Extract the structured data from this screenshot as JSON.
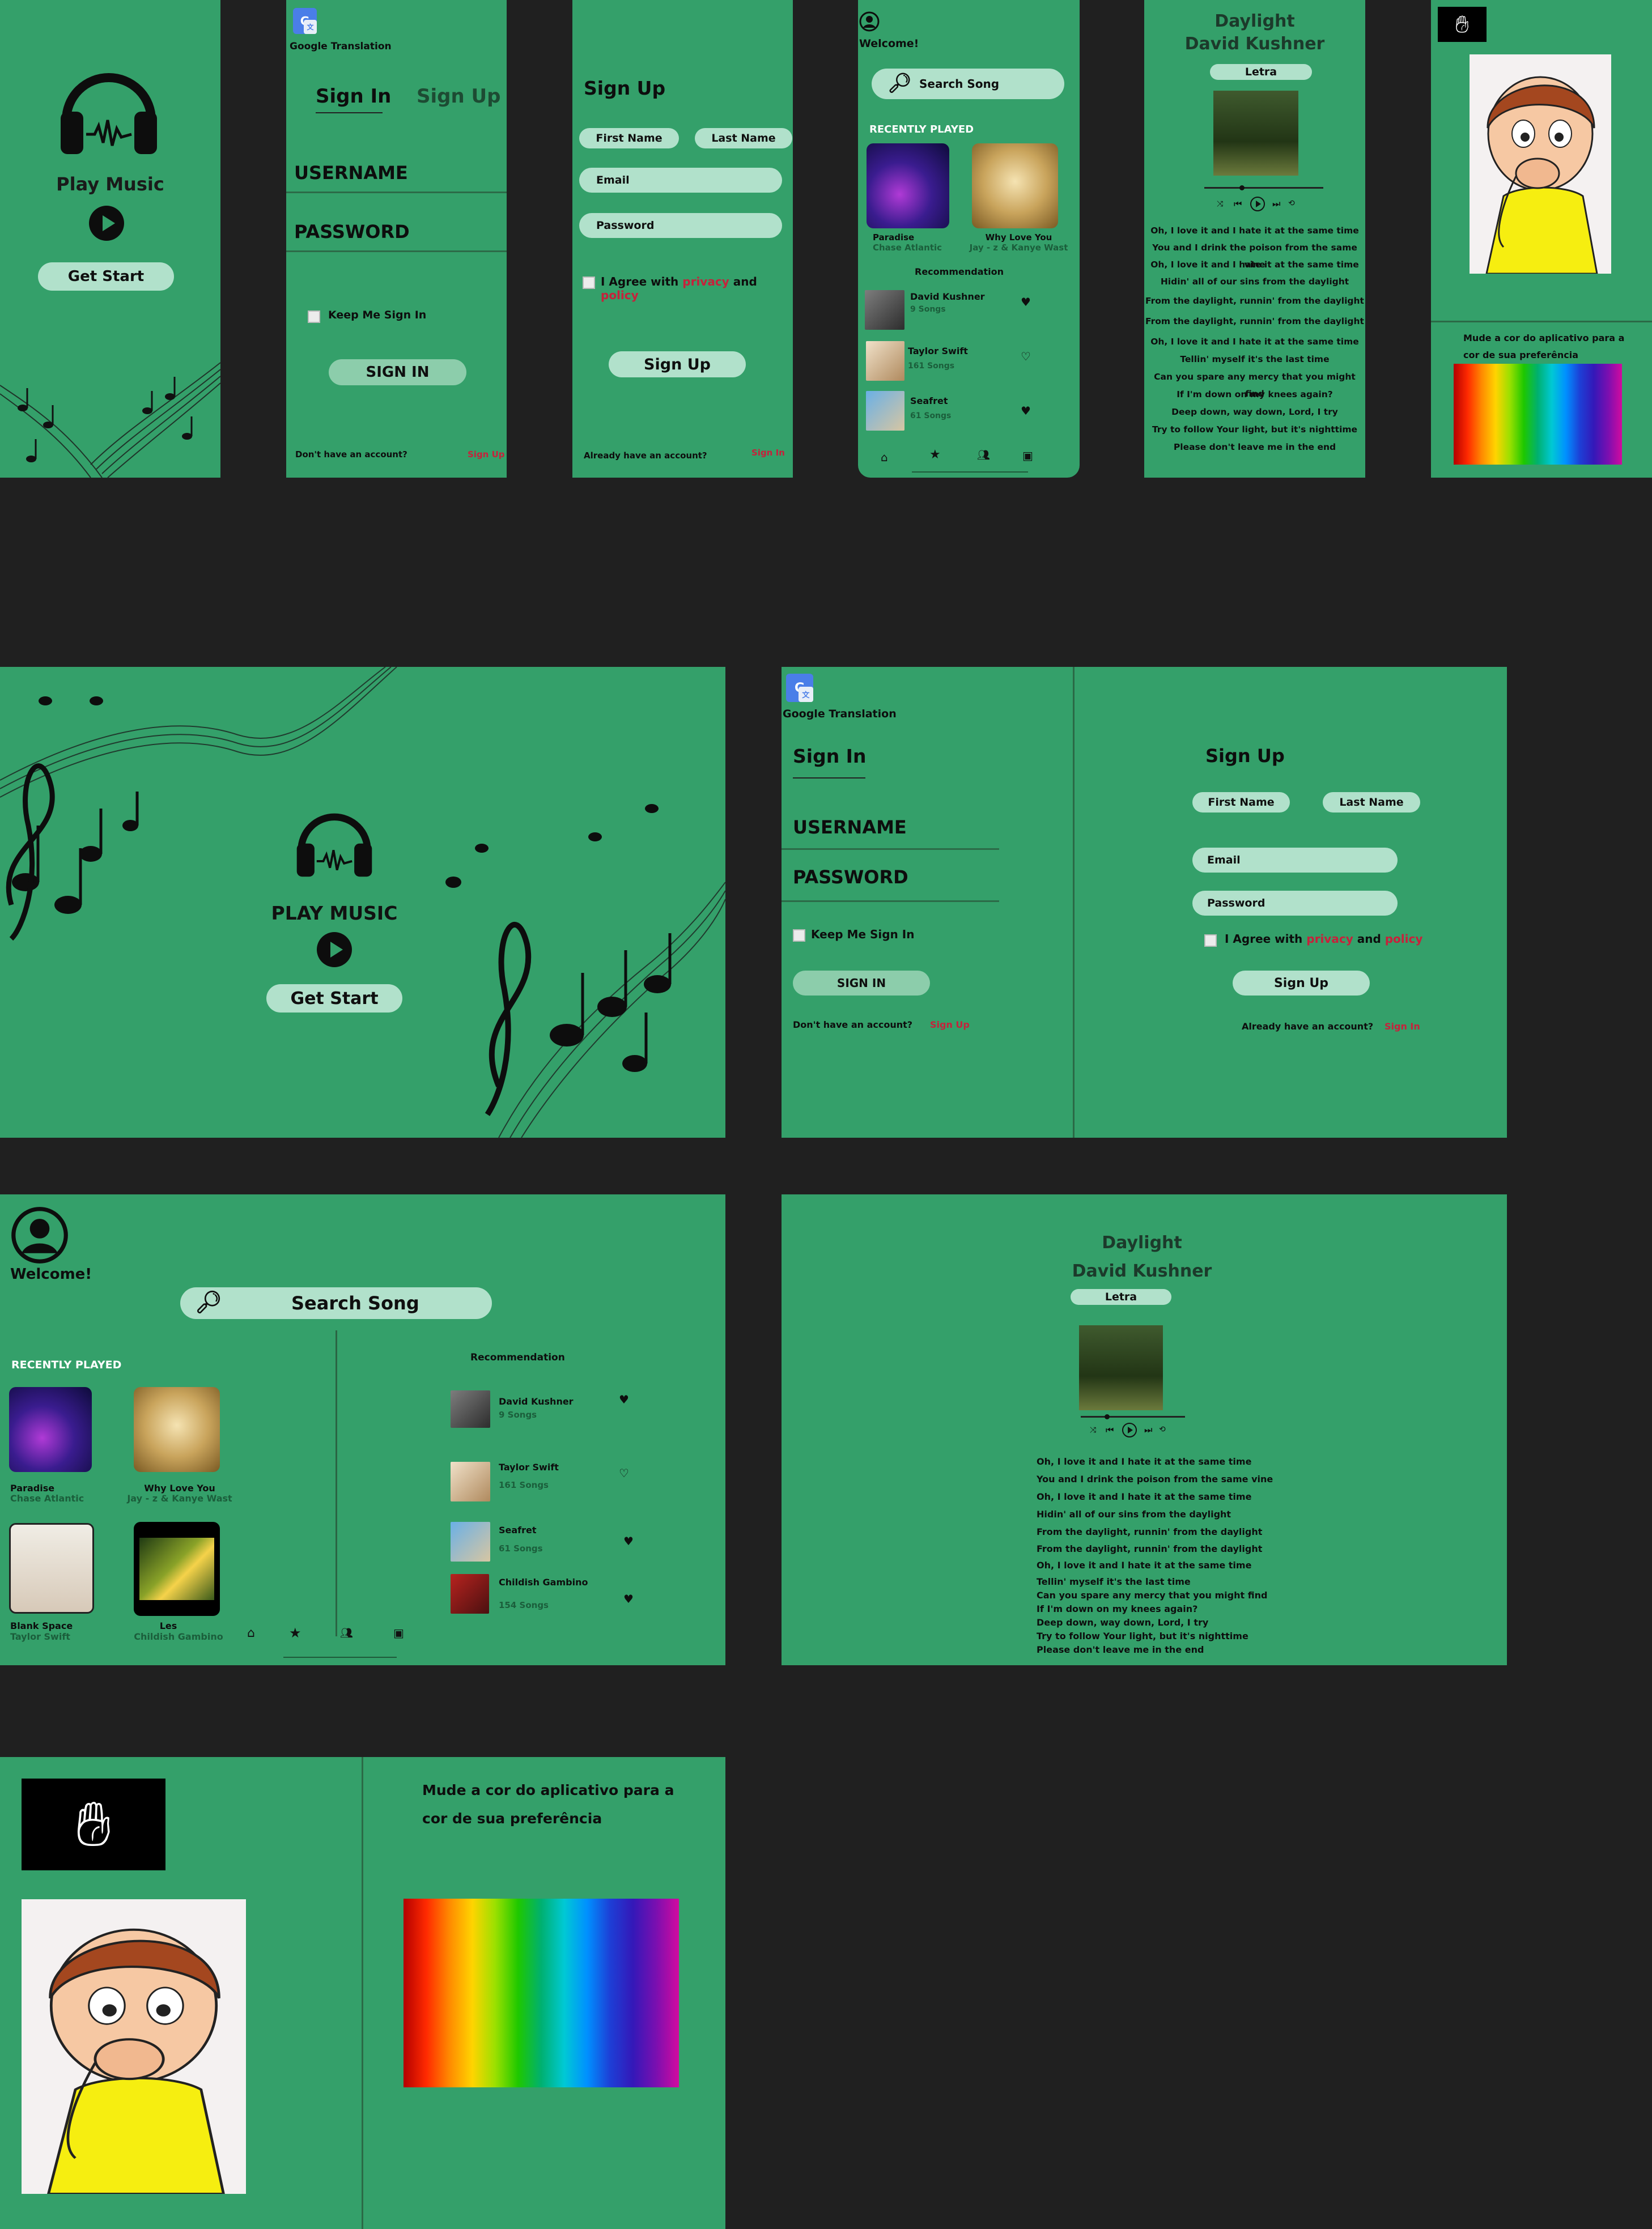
{
  "welcome": {
    "title": "Play Music",
    "title_upper": "PLAY MUSIC",
    "cta": "Get Start"
  },
  "translate": {
    "label": "Google Translation"
  },
  "signin": {
    "tab_signin": "Sign In",
    "tab_signup": "Sign Up",
    "username": "USERNAME",
    "password": "PASSWORD",
    "keep": "Keep Me Sign In",
    "button": "SIGN IN",
    "no_account": "Don't have an account?",
    "signup_link": "Sign Up"
  },
  "signup": {
    "title": "Sign Up",
    "first_name": "First Name",
    "last_name": "Last Name",
    "email": "Email",
    "password": "Password",
    "agree_prefix": "I Agree with",
    "privacy": "privacy",
    "and": "and",
    "policy": "policy",
    "button": "Sign Up",
    "have_account": "Already have an account?",
    "signin_link": "Sign In"
  },
  "home": {
    "welcome": "Welcome!",
    "search_placeholder": "Search Song",
    "recently_played": "RECENTLY PLAYED",
    "recommendation": "Recommendation",
    "recent": [
      {
        "title": "Paradise",
        "artist": "Chase Atlantic"
      },
      {
        "title": "Why Love You",
        "artist": "Jay - z  & Kanye Wast"
      },
      {
        "title": "Blank Space",
        "artist": "Taylor Swift"
      },
      {
        "title": "Les",
        "artist": "Childish Gambino"
      }
    ],
    "rec": [
      {
        "name": "David  Kushner",
        "count": "9 Songs"
      },
      {
        "name": "Taylor Swift",
        "count": "161 Songs"
      },
      {
        "name": "Seafret",
        "count": "61 Songs"
      },
      {
        "name": "Childish Gambino",
        "count": "154 Songs"
      }
    ]
  },
  "player": {
    "song": "Daylight",
    "artist": "David Kushner",
    "lyrics_tab": "Letra",
    "lyrics": [
      "Oh, I love it and I hate it at the same time",
      "You and I drink the poison from the same vine",
      "Oh, I love it and I hate it at the same time",
      "Hidin' all of our sins from the daylight",
      "From the daylight, runnin' from the daylight",
      "From the daylight, runnin' from the daylight",
      "Oh, I love it and I hate it at the same time",
      "Tellin' myself it's the last time",
      "Can you spare any mercy that you might find",
      "If I'm down on my knees again?",
      "Deep down, way down, Lord, I try",
      "Try to follow Your light, but it's nighttime",
      "Please don't leave me in the end"
    ]
  },
  "settings": {
    "text": "Mude  a cor do aplicativo para a cor de sua preferência"
  },
  "colors": {
    "screen": "#34a06a",
    "pill": "#b1e1cb",
    "link": "#c7213b",
    "background": "#202020"
  },
  "icons": [
    "headphones-icon",
    "play-icon",
    "music-notes-icon",
    "translate-icon",
    "search-icon",
    "heart-icon",
    "home-icon",
    "star-icon",
    "people-icon",
    "gallery-icon",
    "user-icon",
    "sign-language-icon",
    "prev-icon",
    "next-icon",
    "shuffle-icon",
    "repeat-icon"
  ]
}
